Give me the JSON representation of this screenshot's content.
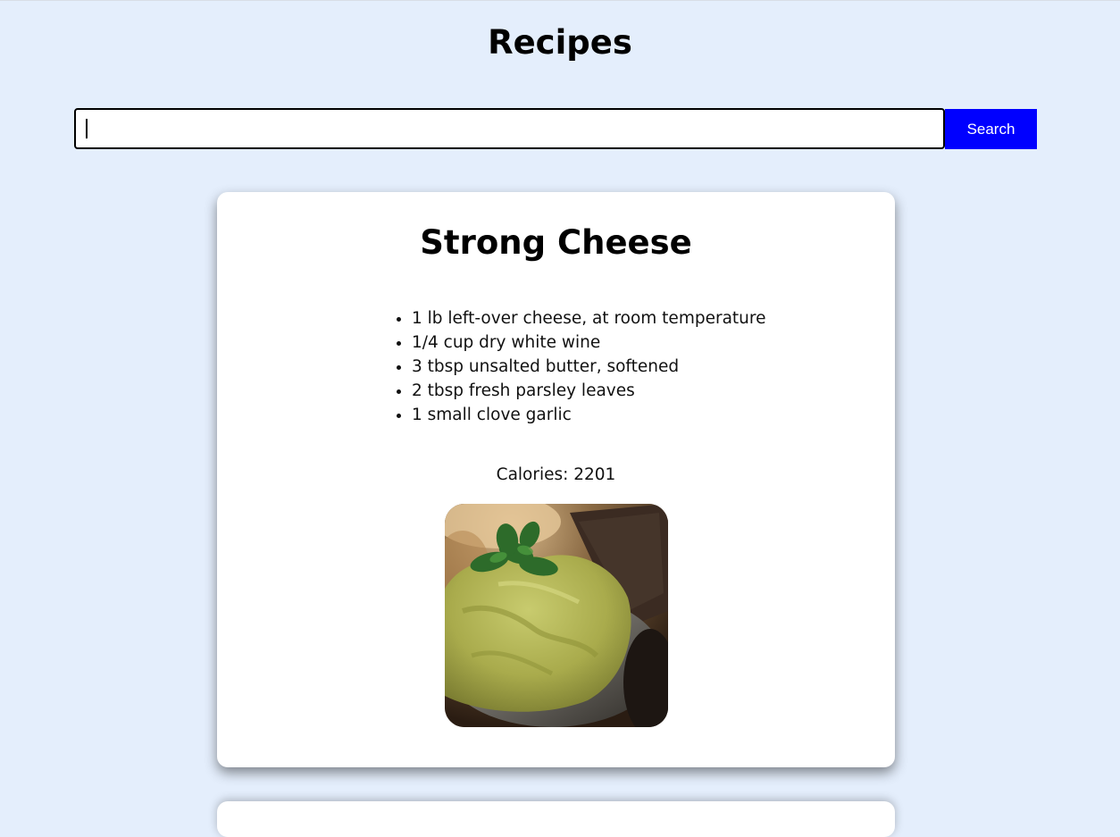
{
  "page": {
    "title": "Recipes"
  },
  "search": {
    "value": "",
    "placeholder": "",
    "button_label": "Search"
  },
  "recipe": {
    "title": "Strong Cheese",
    "ingredients": [
      "1 lb left-over cheese, at room temperature",
      "1/4 cup dry white wine",
      "3 tbsp unsalted butter, softened",
      "2 tbsp fresh parsley leaves",
      "1 small clove garlic"
    ],
    "calories_text": "Calories: 2201",
    "image_alt": "herbed cheese spread in a bowl with parsley garnish"
  },
  "colors": {
    "background": "#e4eefc",
    "card": "#ffffff",
    "search_button": "#0000ff",
    "search_button_text": "#ffffff"
  }
}
